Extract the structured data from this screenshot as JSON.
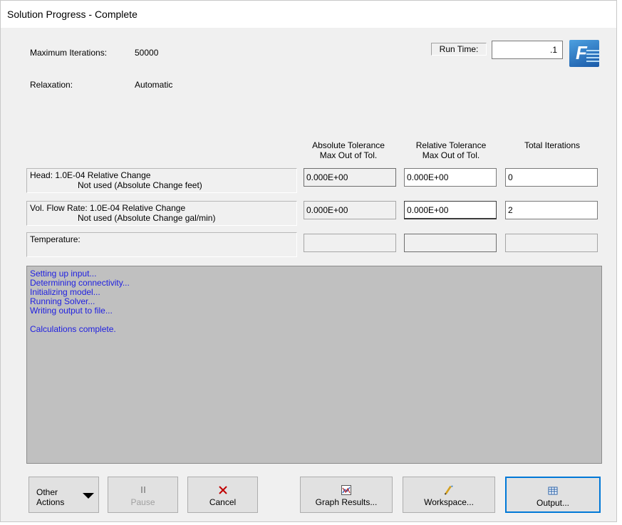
{
  "window": {
    "title": "Solution Progress - Complete"
  },
  "settings": {
    "max_iterations_label": "Maximum Iterations:",
    "max_iterations_value": "50000",
    "relaxation_label": "Relaxation:",
    "relaxation_value": "Automatic",
    "run_time_label": "Run Time:",
    "run_time_value": ".1"
  },
  "logo": {
    "letter": "F",
    "icon": "fathom-logo-icon"
  },
  "columns": {
    "absolute": [
      "Absolute Tolerance",
      "Max Out of Tol."
    ],
    "relative": [
      "Relative Tolerance",
      "Max Out of Tol."
    ],
    "total": "Total Iterations"
  },
  "rows": [
    {
      "label": "Head: 1.0E-04 Relative Change",
      "sublabel": "Not used (Absolute Change feet)",
      "absolute": "0.000E+00",
      "relative": "0.000E+00",
      "total": "0"
    },
    {
      "label": "Vol. Flow Rate: 1.0E-04 Relative Change",
      "sublabel": "Not used (Absolute Change gal/min)",
      "absolute": "0.000E+00",
      "relative": "0.000E+00",
      "total": "2"
    },
    {
      "label": "Temperature:",
      "sublabel": "",
      "absolute": "",
      "relative": "",
      "total": ""
    }
  ],
  "log": [
    "Setting up input...",
    "Determining connectivity...",
    "Initializing model...",
    "Running Solver...",
    "Writing output to file...",
    "",
    "Calculations complete."
  ],
  "buttons": {
    "other_actions": [
      "Other",
      "Actions"
    ],
    "pause": "Pause",
    "cancel": "Cancel",
    "graph_results": "Graph Results...",
    "workspace": "Workspace...",
    "output": "Output..."
  },
  "colors": {
    "log_text": "#2020e0",
    "log_bg": "#c0c0c0",
    "accent": "#0078d7",
    "cancel_icon": "#c00000"
  }
}
